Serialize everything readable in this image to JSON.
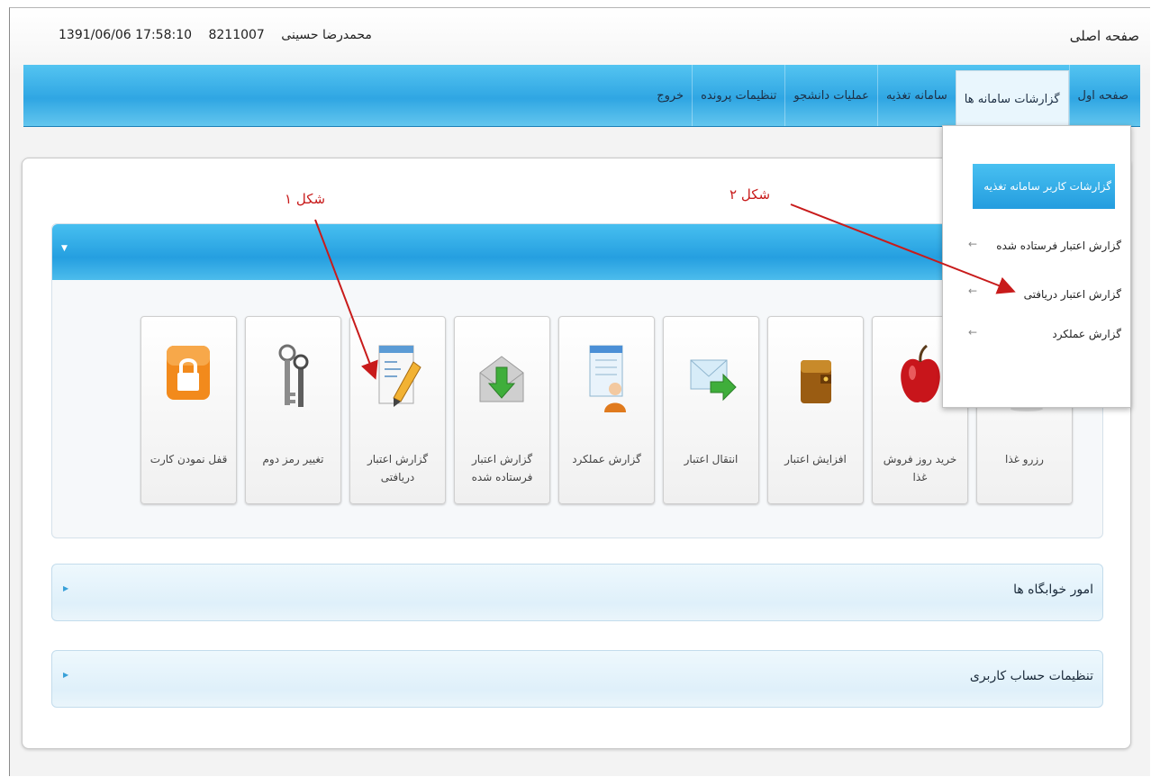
{
  "titlebar": {
    "page_title": "صفحه اصلی",
    "user_name": "محمدرضا حسینی",
    "student_id": "8211007",
    "datetime": "1391/06/06 17:58:10"
  },
  "nav": {
    "items": [
      {
        "label": "صفحه اول"
      },
      {
        "label": "گزارشات سامانه ها"
      },
      {
        "label": "سامانه تغذیه"
      },
      {
        "label": "عملیات دانشجو"
      },
      {
        "label": "تنظیمات پرونده"
      },
      {
        "label": "خروج"
      }
    ]
  },
  "tiles": [
    {
      "label": "رزرو غذا",
      "icon": "food-reserve-icon"
    },
    {
      "label": "خرید روز فروش غذا",
      "icon": "apple-icon"
    },
    {
      "label": "افزایش اعتبار",
      "icon": "wallet-icon"
    },
    {
      "label": "انتقال اعتبار",
      "icon": "envelope-arrow-icon"
    },
    {
      "label": "گزارش عملکرد",
      "icon": "user-report-icon"
    },
    {
      "label": "گزارش اعتبار فرستاده شده",
      "icon": "mail-download-icon"
    },
    {
      "label": "گزارش اعتبار دریافتی",
      "icon": "notepad-pencil-icon"
    },
    {
      "label": "تغییر رمز دوم",
      "icon": "keys-icon"
    },
    {
      "label": "قفل نمودن کارت",
      "icon": "lock-icon"
    }
  ],
  "accordions": [
    {
      "label": "امور خوابگاه ها"
    },
    {
      "label": "تنظیمات حساب کاربری"
    }
  ],
  "dropdown": {
    "header": "گزارشات کاربر سامانه تغذیه",
    "items": [
      {
        "label": "گزارش اعتبار فرستاده شده"
      },
      {
        "label": "گزارش اعتبار دریافتی"
      },
      {
        "label": "گزارش عملکرد"
      }
    ]
  },
  "annotations": {
    "fig1": "شکل ۱",
    "fig2": "شکل ۲"
  },
  "colors": {
    "nav_blue": "#2fa6e3",
    "annotation_red": "#c81b1b"
  }
}
